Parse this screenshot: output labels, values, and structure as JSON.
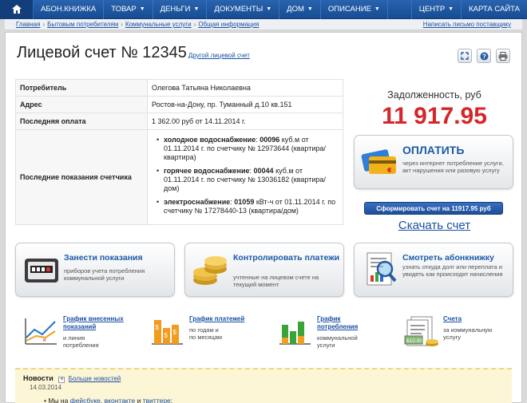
{
  "nav": {
    "items": [
      {
        "label": "АБОН.КНИЖКА",
        "caret": ""
      },
      {
        "label": "ТОВАР",
        "caret": "▼"
      },
      {
        "label": "ДЕНЬГИ",
        "caret": "▼"
      },
      {
        "label": "ДОКУМЕНТЫ",
        "caret": "▼"
      },
      {
        "label": "ДОМ",
        "caret": "▼"
      },
      {
        "label": "ОПИСАНИЕ",
        "caret": "▼"
      }
    ],
    "right": [
      {
        "label": "ЦЕНТР",
        "caret": "▼"
      },
      {
        "label": "КАРТА САЙТА",
        "caret": ""
      }
    ]
  },
  "breadcrumb": {
    "items": [
      "Главная",
      "Бытовым потребителям",
      "Коммунальные услуги",
      "Общая информация"
    ],
    "separator": "›",
    "right_link": "Написать письмо поставщику"
  },
  "account": {
    "title": "Лицевой счет № 12345",
    "other_link": "Другой лицевой счет"
  },
  "info": {
    "consumer_label": "Потребитель",
    "consumer": "Олегова Татьяна Николаевна",
    "address_label": "Адрес",
    "address": "Ростов-на-Дону, пр. Туманный д.10 кв.151",
    "last_payment_label": "Последняя оплата",
    "last_payment": "1 362.00 руб от 14.11.2014 г.",
    "readings_label": "Последние показания счетчика",
    "readings": [
      {
        "name": "холодное водоснабжение",
        "value": "00096",
        "text": " куб.м от 01.11.2014 г. по счетчику № 12973644 (квартира/квартира)"
      },
      {
        "name": "горячее водоснабжение",
        "value": "00044",
        "text": " куб.м от 01.11.2014 г. по счетчику № 13036182 (квартира/дом)"
      },
      {
        "name": "электроснабжение",
        "value": "01059",
        "text": " кВт-ч от 01.11.2014 г. по счетчику № 17278440-13 (квартира/дом)"
      }
    ]
  },
  "debt": {
    "label": "Задолженность, руб",
    "value": "11 917.95"
  },
  "pay": {
    "title": "ОПЛАТИТЬ",
    "desc": "через интернет потребление услуги, акт нарушения или разовую услугу"
  },
  "generate_button": "Сформировать счет на 11917.95 руб",
  "download_link": "Скачать счет",
  "actions": [
    {
      "title": "Занести показания",
      "desc": "приборов учета потребления коммунальной услуги"
    },
    {
      "title": "Контролировать платежи",
      "desc": "учтенные на лицевом счете на текущий момент"
    },
    {
      "title": "Смотреть абонкнижку",
      "desc": "узнать откуда долг или переплата и увидеть как происходят начисления"
    }
  ],
  "graphs": [
    {
      "title_1": "График внесенных",
      "title_2": "показаний",
      "desc_1": "и линия",
      "desc_2": "потребления"
    },
    {
      "title_1": "График платежей",
      "title_2": "",
      "desc_1": "по годам и",
      "desc_2": "по месяцам"
    },
    {
      "title_1": "График",
      "title_2": "потребления",
      "desc_1": "коммунальной",
      "desc_2": "услуги"
    },
    {
      "title_1": "Счета",
      "title_2": "",
      "desc_1": "за коммунальную",
      "desc_2": "услугу"
    }
  ],
  "news": {
    "label": "Новости",
    "more": "Больше новостей",
    "date": "14.03.2014",
    "item_prefix": "Мы на ",
    "link1": "фейсбуке",
    "sep1": ", ",
    "link2": "вконтакте",
    "sep2": " и ",
    "link3": "твиттере",
    "suffix": ";"
  },
  "colors": {
    "accent": "#1c5aa8",
    "debt": "#d6262a",
    "nav": "#1e57a0"
  }
}
